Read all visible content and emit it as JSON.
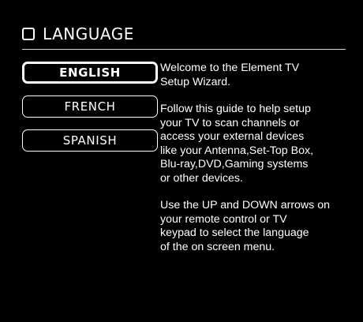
{
  "header": {
    "icon": "square-outline-icon",
    "title": "LANGUAGE"
  },
  "menu": {
    "items": [
      {
        "label": "ENGLISH",
        "selected": true
      },
      {
        "label": "FRENCH",
        "selected": false
      },
      {
        "label": "SPANISH",
        "selected": false
      }
    ]
  },
  "info": {
    "paragraphs": [
      "Welcome to the Element TV\nSetup Wizard.",
      "Follow this guide to help setup\nyour TV to scan channels or\naccess your external devices\nlike your Antenna,Set-Top Box,\nBlu-ray,DVD,Gaming systems\nor other devices.",
      "Use the UP and DOWN arrows on\nyour remote control or TV\nkeypad to select the language\nof the on screen menu."
    ]
  },
  "colors": {
    "background": "#000000",
    "foreground": "#ffffff"
  }
}
